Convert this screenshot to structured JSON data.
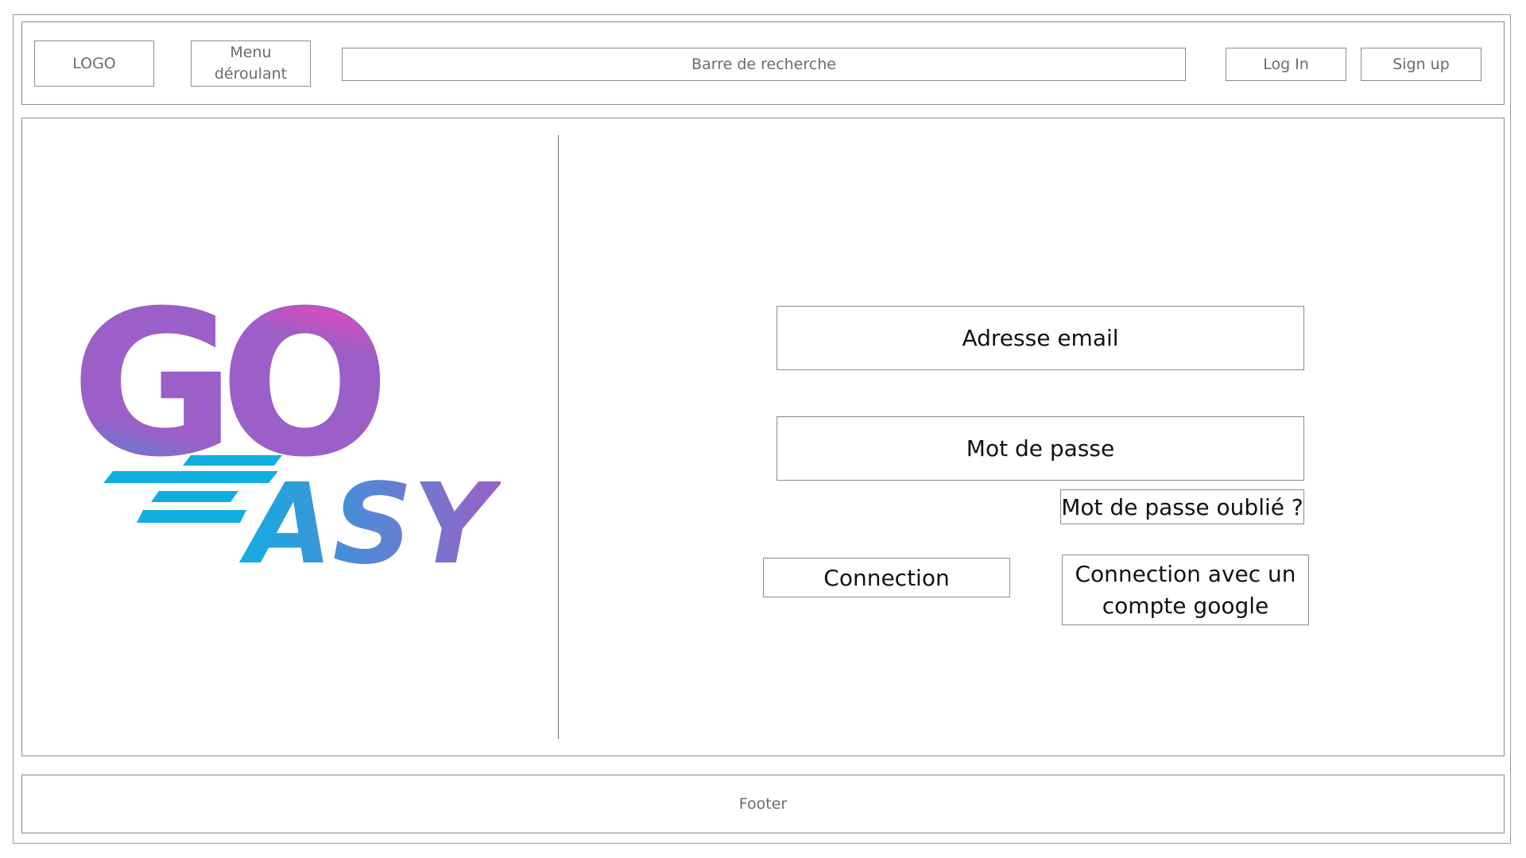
{
  "header": {
    "logo_label": "LOGO",
    "menu_label_line1": "Menu",
    "menu_label_line2": "déroulant",
    "search_placeholder": "Barre de recherche",
    "login_label": "Log In",
    "signup_label": "Sign up"
  },
  "brand": {
    "logo_text_top": "GO",
    "logo_text_bottom": "ASY",
    "colors": {
      "purple": "#9b5fc7",
      "pink": "#d94bbf",
      "cyan": "#10aee0"
    }
  },
  "form": {
    "email_label": "Adresse email",
    "password_label": "Mot de passe",
    "forgot_label": "Mot de passe oublié ?",
    "connect_label": "Connection",
    "google_line1": "Connection avec un",
    "google_line2": "compte google"
  },
  "footer": {
    "label": "Footer"
  }
}
